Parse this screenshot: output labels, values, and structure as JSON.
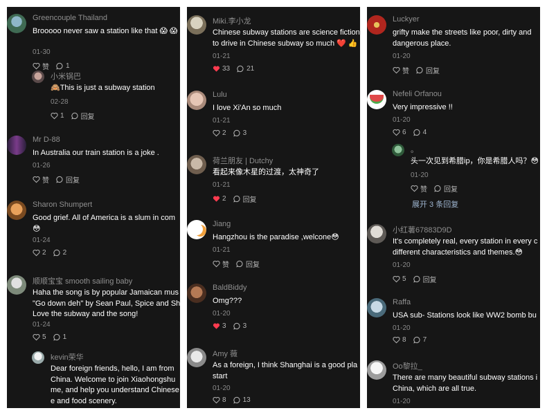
{
  "panels": [
    {
      "comments": [
        {
          "author": "Greencouple Thailand",
          "text": "Brooooo never saw a station like that 😱 😱",
          "date": "01-30",
          "like_label": "赞",
          "reply_count": "1"
        },
        {
          "author": "小米锅巴",
          "text": "🙈This is just a subway station",
          "date": "02-28",
          "like_count": "1",
          "reply_label": "回复"
        },
        {
          "author": "Mr D-88",
          "text": "In Australia our train station is a joke .",
          "date": "01-26",
          "like_label": "赞",
          "reply_label": "回复"
        },
        {
          "author": "Sharon Shumpert",
          "text": "Good grief. All of America is a slum in com\n😳",
          "date": "01-24",
          "like_count": "2",
          "reply_count": "2"
        },
        {
          "author": "顺顺宝宝 smooth sailing baby",
          "text": "Haha the song is by popular Jamaican mus\n\"Go down deh\" by Sean Paul, Spice and Sh\nLove the subway and the song!",
          "date": "01-24",
          "like_count": "5",
          "reply_count": "1"
        },
        {
          "author": "kevin荣华",
          "text": "Dear foreign friends, hello, I am from\nChina. Welcome to join Xiaohongshu\nme, and help you understand Chinese\ne and food scenery."
        }
      ]
    },
    {
      "comments": [
        {
          "author": "Miki.李小龙",
          "text": "Chinese subway stations are science fiction\nto drive in Chinese subway so much ❤️ 👍",
          "date": "01-21",
          "like_count": "33",
          "reply_count": "21"
        },
        {
          "author": "Lulu",
          "text": "I love Xi'An so much",
          "date": "01-21",
          "like_count": "2",
          "reply_count": "3"
        },
        {
          "author": "荷兰朋友 | Dutchy",
          "text": "看起来像木星的过渡，太神奇了",
          "date": "01-21",
          "like_count": "2",
          "reply_label": "回复"
        },
        {
          "author": "Jiang",
          "text": "Hangzhou is the paradise ,welcone😳",
          "date": "01-21",
          "like_label": "赞",
          "reply_label": "回复"
        },
        {
          "author": "BaldBiddy",
          "text": "Omg???",
          "date": "01-20",
          "like_count": "3",
          "reply_count": "3"
        },
        {
          "author": "Amy 薇",
          "text": "As a foreign, I think Shanghai is a good pla\nstart",
          "date": "01-20",
          "like_count": "8",
          "reply_count": "13"
        }
      ]
    },
    {
      "comments": [
        {
          "author": "Luckyer",
          "text": "grifty make the streets like poor, dirty and\ndangerous place.",
          "date": "01-20",
          "like_label": "赞",
          "reply_label": "回复"
        },
        {
          "author": "Nefeli Orfanou",
          "text": "Very impressive !!",
          "date": "01-20",
          "like_count": "6",
          "reply_count": "4"
        },
        {
          "author": "。",
          "text": "头一次见到希腊ip，你是希腊人吗？😳",
          "date": "01-20",
          "like_label": "赞",
          "reply_label": "回复"
        },
        {
          "expand": "展开 3 条回复"
        },
        {
          "author": "小红薯67883D9D",
          "text": "It's completely real, every station in every c\ndifferent characteristics and themes.😳",
          "date": "01-20",
          "like_count": "5",
          "reply_label": "回复"
        },
        {
          "author": "Raffa",
          "text": "USA sub- Stations look like WW2 bomb bu",
          "date": "01-20",
          "like_count": "8",
          "reply_count": "7"
        },
        {
          "author": "Oo黎拉_",
          "text": "There are many beautiful subway stations i\nChina, which are all true.",
          "date": "01-20"
        }
      ]
    }
  ],
  "colors": {
    "background": "#161616",
    "text": "#ffffff",
    "muted": "#8f8f8f",
    "liked": "#ff3b4f",
    "link": "#9db4cf"
  },
  "icons": {
    "like": "heart-outline-icon",
    "liked": "heart-filled-icon",
    "reply": "comment-bubble-icon"
  }
}
